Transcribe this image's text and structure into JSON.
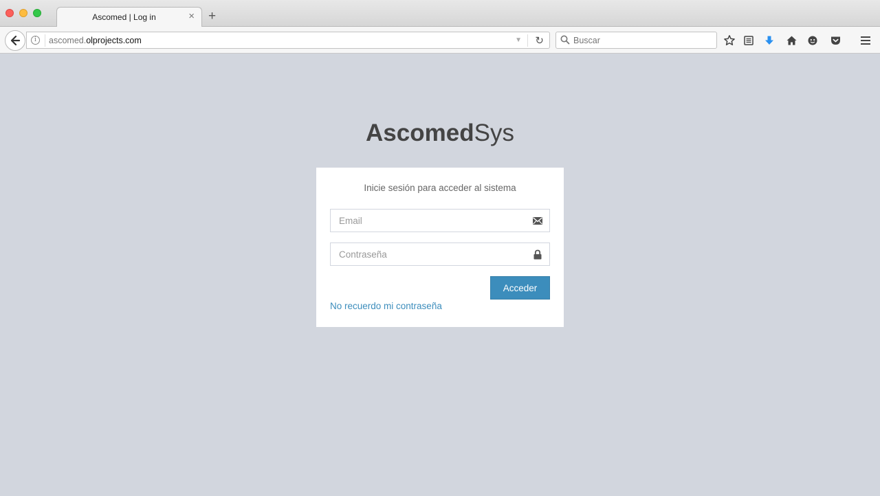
{
  "browser": {
    "tab_title": "Ascomed | Log in",
    "tab_close": "×",
    "new_tab": "+",
    "url_prefix": "ascomed.",
    "url_host": "olprojects.com",
    "search_placeholder": "Buscar",
    "icons": [
      "back-icon",
      "info-icon",
      "reload-icon",
      "search-icon",
      "bookmark-star-icon",
      "reading-list-icon",
      "download-icon",
      "home-icon",
      "sync-icon",
      "pocket-icon",
      "menu-icon"
    ],
    "download_color": "#2a90f0"
  },
  "page": {
    "logo_bold": "Ascomed",
    "logo_light": "Sys",
    "box_message": "Inicie sesión para acceder al sistema",
    "email_placeholder": "Email",
    "password_placeholder": "Contraseña",
    "submit_label": "Acceder",
    "forgot_link": "No recuerdo mi contraseña",
    "accent_color": "#3c8dbc",
    "background_color": "#d2d6de"
  }
}
